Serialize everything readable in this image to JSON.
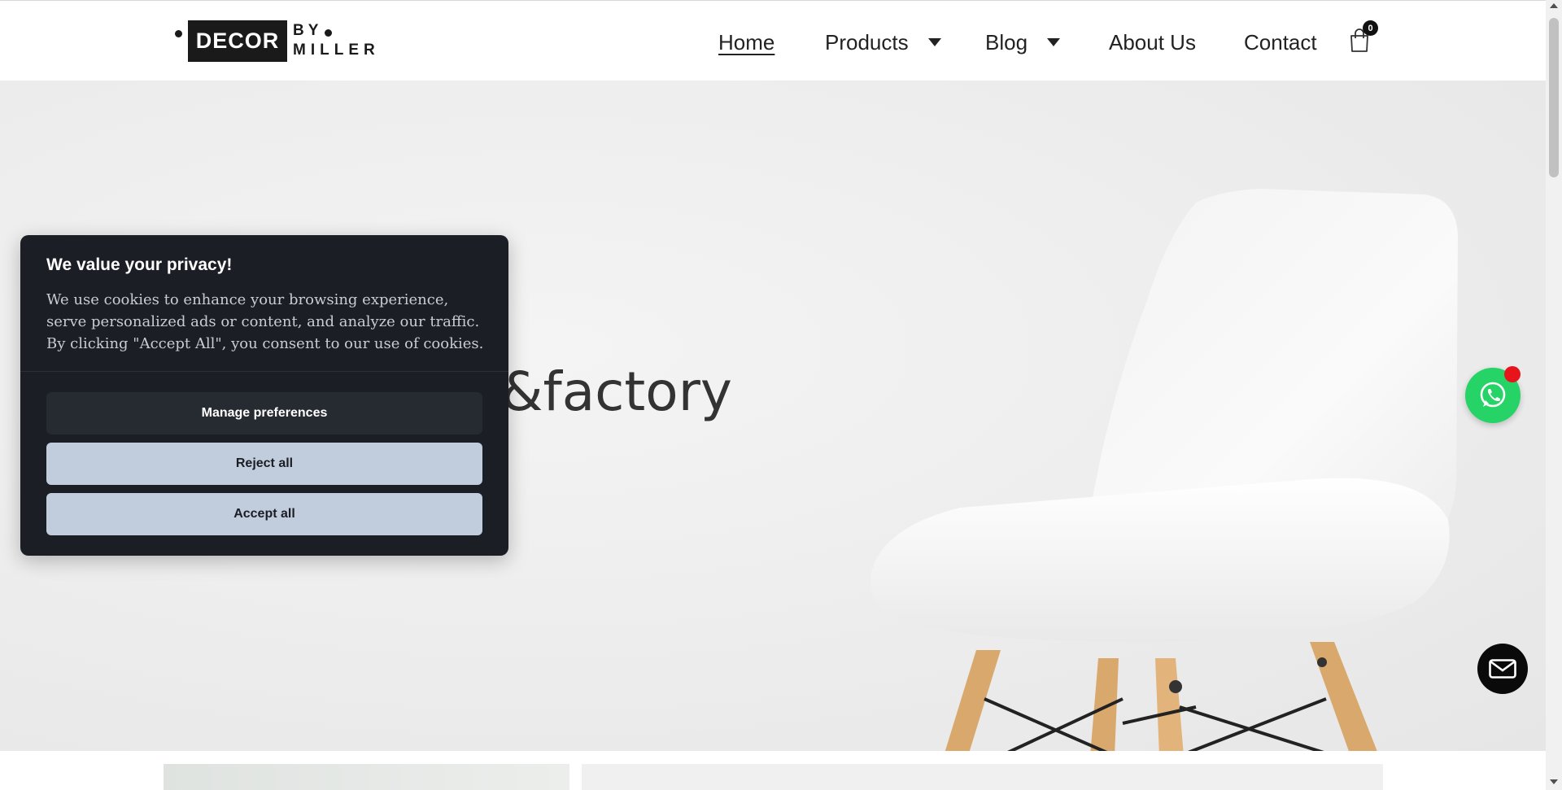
{
  "brand": {
    "logo_main": "DECOR",
    "logo_by": "BY",
    "logo_sub": "MILLER"
  },
  "nav": {
    "items": [
      {
        "label": "Home",
        "active": true
      },
      {
        "label": "Products",
        "has_dropdown": true
      },
      {
        "label": "Blog",
        "has_dropdown": true
      },
      {
        "label": "About Us"
      },
      {
        "label": "Contact"
      }
    ],
    "cart_count": "0",
    "cart_icon": "shopping-bag-icon"
  },
  "hero": {
    "visible_text": "&factory"
  },
  "cookie_banner": {
    "title": "We value your privacy!",
    "description": "We use cookies to enhance your browsing experience, serve personalized ads or content, and analyze our traffic. By clicking \"Accept All\", you consent to our use of cookies.",
    "buttons": {
      "manage": "Manage preferences",
      "reject": "Reject all",
      "accept": "Accept all"
    }
  },
  "floating": {
    "whatsapp_icon": "whatsapp-icon",
    "mail_icon": "mail-icon"
  },
  "colors": {
    "whatsapp_green": "#25d366",
    "notification_red": "#e8141b",
    "cookie_bg": "#1b1e24",
    "cookie_button": "#c1cddd"
  }
}
